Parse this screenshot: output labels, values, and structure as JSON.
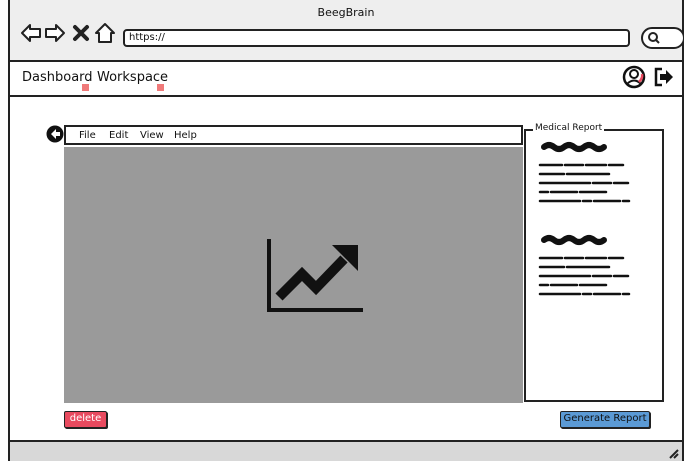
{
  "browser": {
    "title": "BeegBrain",
    "url": "https://",
    "nav_icons": [
      "back-arrow-icon",
      "forward-arrow-icon",
      "close-icon",
      "home-icon"
    ],
    "search_icon": "search-icon"
  },
  "appnav": {
    "links": [
      {
        "label": "Dashboard"
      },
      {
        "label": "Workspace"
      }
    ],
    "icons": [
      "user-icon",
      "sign-out-icon"
    ],
    "marker_color": "#f07a7a"
  },
  "editor": {
    "back_icon": "back-circle-icon",
    "menu": [
      {
        "label": "File"
      },
      {
        "label": "Edit"
      },
      {
        "label": "View"
      },
      {
        "label": "Help"
      }
    ],
    "canvas_icon": "trending-up-chart-icon",
    "canvas_color": "#9a9a9a"
  },
  "report": {
    "title": "Medical Report"
  },
  "actions": {
    "delete_label": "delete",
    "generate_label": "Generate Report",
    "delete_color": "#e84a5f",
    "generate_color": "#5b9ad5"
  }
}
